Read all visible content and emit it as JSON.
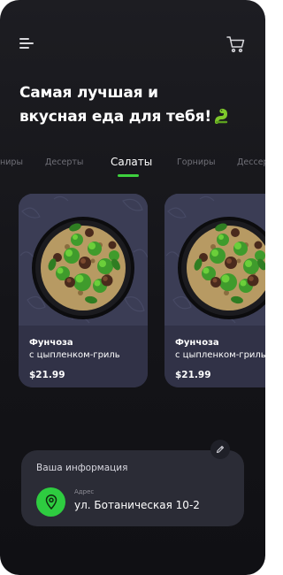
{
  "header": {
    "headline_line1": "Самая лучшая и",
    "headline_line2": "вкусная еда для тебя!"
  },
  "tabs": [
    {
      "label": "рниры"
    },
    {
      "label": "Десерты"
    },
    {
      "label": "Салаты",
      "active": true
    },
    {
      "label": "Горниры"
    },
    {
      "label": "Дессер"
    }
  ],
  "products": [
    {
      "title": "Фунчоза",
      "subtitle": "с цыпленком-гриль",
      "price": "$21.99"
    },
    {
      "title": "Фунчоза",
      "subtitle": "с цыпленком-гриль",
      "price": "$21.99"
    }
  ],
  "user_info": {
    "heading": "Ваша информация",
    "address_caption": "Адрес",
    "address_value": "ул. Ботаническая 10-2"
  },
  "icons": {
    "menu": "menu-icon",
    "cart": "cart-icon",
    "headline_emoji": "snake-icon",
    "location": "location-pin-icon",
    "edit": "pencil-icon"
  },
  "colors": {
    "background": "#17171b",
    "accent": "#3ed13e",
    "card": "#333449",
    "info_card": "#2b2c36"
  }
}
